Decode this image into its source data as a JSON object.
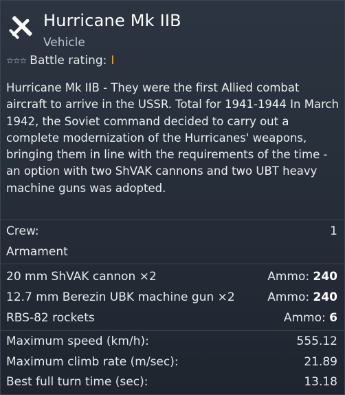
{
  "vehicle": {
    "name": "Hurricane Mk IIB",
    "type": "Vehicle",
    "icon": "fighter-plane-icon",
    "battle_rating_label": "Battle rating:",
    "battle_rating_value": "I",
    "rank_stars": "☆☆☆"
  },
  "description": "Hurricane Mk IIB - They were the first Allied combat aircraft to arrive in the USSR. Total for 1941-1944 In March 1942, the Soviet command decided to carry out a complete modernization of the Hurricanes' weapons, bringing them in line with the requirements of the time - an option with two ShVAK cannons and two UBT heavy machine guns was adopted.",
  "crew": {
    "label": "Crew:",
    "value": "1"
  },
  "armament": {
    "heading": "Armament",
    "ammo_label": "Ammo:",
    "items": [
      {
        "name": "20 mm ShVAK cannon ×2",
        "ammo": "240"
      },
      {
        "name": "12.7 mm Berezin UBK machine gun ×2",
        "ammo": "240"
      },
      {
        "name": "RBS-82 rockets",
        "ammo": "6"
      }
    ]
  },
  "performance": [
    {
      "label": "Maximum speed (km/h):",
      "value": "555.12"
    },
    {
      "label": "Maximum climb rate (m/sec):",
      "value": "21.89"
    },
    {
      "label": "Best full turn time (sec):",
      "value": "13.18"
    }
  ],
  "colors": {
    "background": "#28303c",
    "accent_rating": "#f2a520",
    "subtitle": "#b9c4cf",
    "separator": "#3d4552"
  }
}
